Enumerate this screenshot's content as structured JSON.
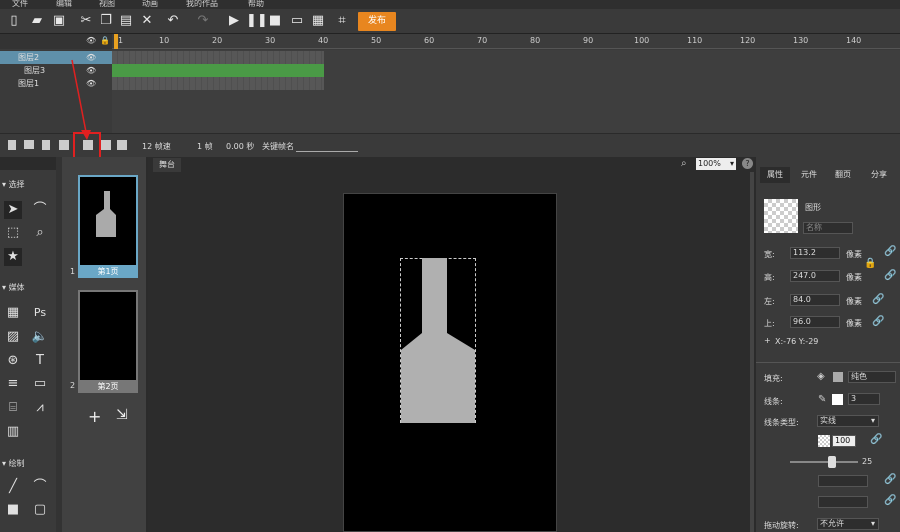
{
  "menu": [
    "文件",
    "编辑",
    "视图",
    "动画",
    "我的作品",
    "帮助"
  ],
  "toolbar": {
    "publish_label": "发布"
  },
  "timeline": {
    "ruler_ticks": [
      "1",
      "10",
      "20",
      "30",
      "40",
      "50",
      "60",
      "70",
      "80",
      "90",
      "100",
      "110",
      "120",
      "130",
      "140"
    ],
    "layers": [
      "图层2",
      "图层3",
      "图层1"
    ],
    "fps": "12 帧速",
    "frame": "1 帧",
    "seconds": "0.00 秒",
    "keyframe_name_label": "关键帧名"
  },
  "tools": {
    "select_label": "选择",
    "media_label": "媒体",
    "draw_label": "绘制"
  },
  "pages": {
    "page1": "1",
    "page1_label": "第1页",
    "page2": "2",
    "page2_label": "第2页"
  },
  "stage": {
    "tab_label": "舞台",
    "zoom": "100%"
  },
  "props": {
    "tabs": [
      "属性",
      "元件",
      "翻页",
      "分享"
    ],
    "shape_type": "图形",
    "name_placeholder": "名称",
    "width_label": "宽:",
    "width_value": "113.2",
    "height_label": "高:",
    "height_value": "247.0",
    "left_label": "左:",
    "left_value": "84.0",
    "top_label": "上:",
    "top_value": "96.0",
    "unit": "像素",
    "coords": "X:-76    Y:-29",
    "fill_label": "填充:",
    "fill_type": "纯色",
    "stroke_label": "线条:",
    "stroke_value": "3",
    "stroke_type_label": "线条类型:",
    "stroke_type": "实线",
    "opacity_value": "100",
    "slider_value": "25",
    "drag_rotate_label": "拖动旋转:",
    "drag_rotate_value": "不允许"
  }
}
